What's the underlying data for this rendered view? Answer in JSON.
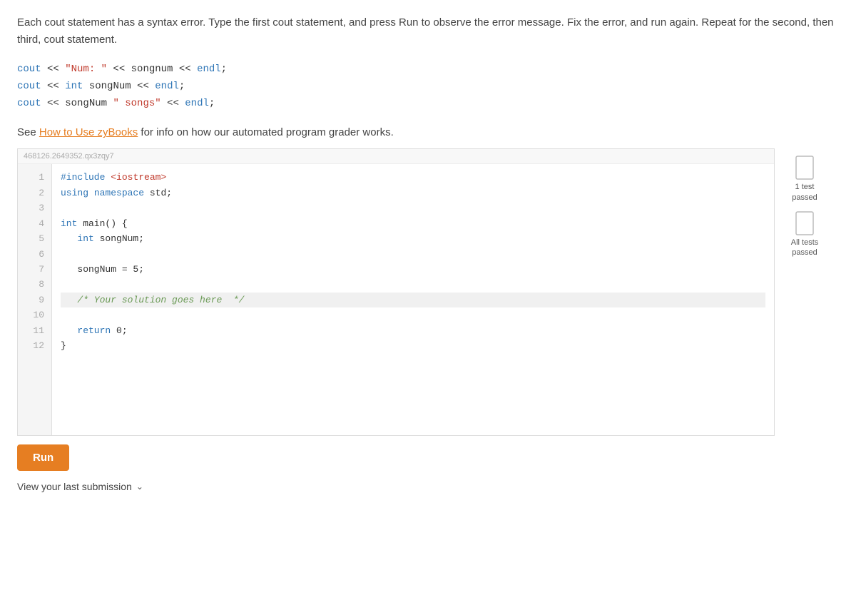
{
  "instructions": {
    "paragraph": "Each cout statement has a syntax error. Type the first cout statement, and press Run to observe the error message. Fix the error, and run again. Repeat for the second, then third, cout statement."
  },
  "code_examples": [
    "cout << \"Num: \" << songnum << endl;",
    "cout << int songNum << endl;",
    "cout << songNum \" songs\" << endl;"
  ],
  "see_line": {
    "prefix": "See ",
    "link_text": "How to Use zyBooks",
    "suffix": " for info on how our automated program grader works."
  },
  "editor": {
    "id": "468126.2649352.qx3zqy7",
    "lines": [
      {
        "num": 1,
        "content": "#include <iostream>",
        "highlighted": false
      },
      {
        "num": 2,
        "content": "using namespace std;",
        "highlighted": false
      },
      {
        "num": 3,
        "content": "",
        "highlighted": false
      },
      {
        "num": 4,
        "content": "int main() {",
        "highlighted": false
      },
      {
        "num": 5,
        "content": "   int songNum;",
        "highlighted": false
      },
      {
        "num": 6,
        "content": "",
        "highlighted": false
      },
      {
        "num": 7,
        "content": "   songNum = 5;",
        "highlighted": false
      },
      {
        "num": 8,
        "content": "",
        "highlighted": false
      },
      {
        "num": 9,
        "content": "   /* Your solution goes here  */",
        "highlighted": true
      },
      {
        "num": 10,
        "content": "",
        "highlighted": false
      },
      {
        "num": 11,
        "content": "   return 0;",
        "highlighted": false
      },
      {
        "num": 12,
        "content": "}",
        "highlighted": false
      }
    ]
  },
  "badges": [
    {
      "id": "badge-1-test",
      "label": "1 test\npassed"
    },
    {
      "id": "badge-all-tests",
      "label": "All tests\npassed"
    }
  ],
  "buttons": {
    "run": "Run",
    "view_submission": "View your last submission"
  }
}
